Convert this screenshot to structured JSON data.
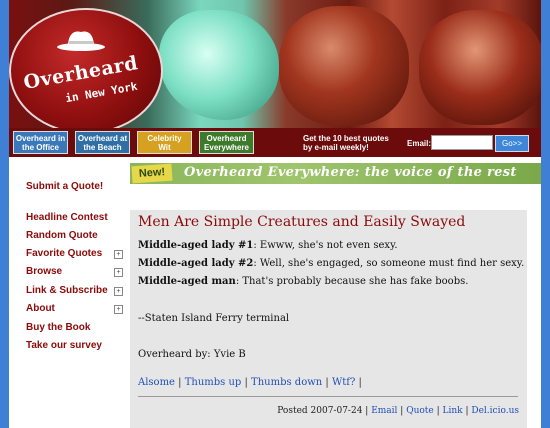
{
  "header": {
    "logo_title": "Overheard",
    "logo_sub": "in New York",
    "nav_badges": [
      {
        "line1": "Overheard in",
        "line2": "the Office"
      },
      {
        "line1": "Overheard at",
        "line2": "the Beach"
      },
      {
        "line1": "Celebrity",
        "line2": "Wit"
      },
      {
        "line1": "Overheard",
        "line2": "Everywhere"
      }
    ],
    "promo_line1": "Get the 10 best quotes",
    "promo_line2": "by e-mail weekly!",
    "email_label": "Email:",
    "email_value": "",
    "go_label": "Go>>"
  },
  "banner": {
    "new_label": "New!",
    "text": "Overheard Everywhere: the voice of the rest"
  },
  "sidebar": {
    "submit": "Submit a Quote!",
    "items": [
      {
        "label": "Headline Contest",
        "expandable": false
      },
      {
        "label": "Random Quote",
        "expandable": false
      },
      {
        "label": "Favorite Quotes",
        "expandable": true
      },
      {
        "label": "Browse",
        "expandable": true
      },
      {
        "label": "Link & Subscribe",
        "expandable": true
      },
      {
        "label": "About",
        "expandable": true
      },
      {
        "label": "Buy the Book",
        "expandable": false
      },
      {
        "label": "Take our survey",
        "expandable": false
      }
    ],
    "plus_symbol": "+"
  },
  "post": {
    "title": "Men Are Simple Creatures and Easily Swayed",
    "lines": [
      {
        "speaker": "Middle-aged lady #1",
        "text": ": Ewww, she's not even sexy."
      },
      {
        "speaker": "Middle-aged lady #2",
        "text": ": Well, she's engaged, so someone must find her sexy."
      },
      {
        "speaker": "Middle-aged man",
        "text": ": That's probably because she has fake boobs."
      }
    ],
    "location": "--Staten Island Ferry terminal",
    "overheard_by": "Overheard by: Yvie B",
    "actions": [
      "Alsome",
      "Thumbs up",
      "Thumbs down",
      "Wtf?"
    ],
    "posted_label": "Posted 2007-07-24",
    "footer_links": [
      "Email",
      "Quote",
      "Link",
      "Del.icio.us"
    ]
  }
}
